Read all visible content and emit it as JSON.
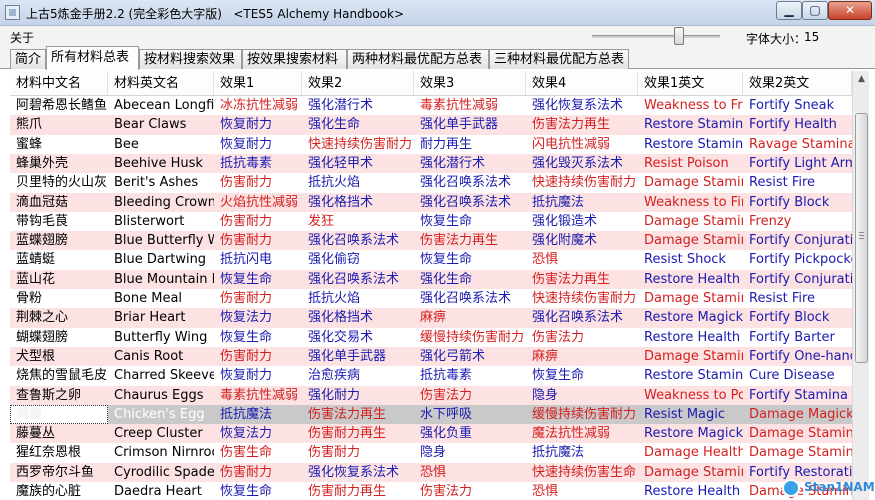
{
  "window": {
    "title": "上古5炼金手册2.2 (完全彩色大字版)   <TES5 Alchemy Handbook>"
  },
  "menu": {
    "about": "关于"
  },
  "font_size": {
    "label": "字体大小：",
    "value": "15",
    "slider_fraction": 0.68
  },
  "tabs": [
    "简介",
    "所有材料总表",
    "按材料搜索效果",
    "按效果搜索材料",
    "两种材料最优配方总表",
    "三种材料最优配方总表"
  ],
  "active_tab": 1,
  "columns": [
    "材料中文名",
    "材料英文名",
    "效果1",
    "效果2",
    "效果3",
    "效果4",
    "效果1英文",
    "效果2英文"
  ],
  "rows": [
    [
      "阿碧希恩长鳍鱼",
      "Abecean Longfin",
      "冰冻抗性减弱",
      "强化潜行术",
      "毒素抗性减弱",
      "强化恢复系法术",
      "Weakness to Frost",
      "Fortify Sneak"
    ],
    [
      "熊爪",
      "Bear Claws",
      "恢复耐力",
      "强化生命",
      "强化单手武器",
      "伤害法力再生",
      "Restore Stamina",
      "Fortify Health"
    ],
    [
      "蜜蜂",
      "Bee",
      "恢复耐力",
      "快速持续伤害耐力",
      "耐力再生",
      "闪电抗性减弱",
      "Restore Stamina",
      "Ravage Stamina"
    ],
    [
      "蜂巢外壳",
      "Beehive Husk",
      "抵抗毒素",
      "强化轻甲术",
      "强化潜行术",
      "强化毁灭系法术",
      "Resist Poison",
      "Fortify Light Armor"
    ],
    [
      "贝里特的火山灰",
      "Berit's Ashes",
      "伤害耐力",
      "抵抗火焰",
      "强化召唤系法术",
      "快速持续伤害耐力",
      "Damage Stamina",
      "Resist Fire"
    ],
    [
      "滴血冠菇",
      "Bleeding Crown",
      "火焰抗性减弱",
      "强化格挡术",
      "强化召唤系法术",
      "抵抗魔法",
      "Weakness to Fire",
      "Fortify Block"
    ],
    [
      "带钩毛茛",
      "Blisterwort",
      "伤害耐力",
      "发狂",
      "恢复生命",
      "强化锻造术",
      "Damage Stamina",
      "Frenzy"
    ],
    [
      "蓝蝶翅膀",
      "Blue Butterfly Wing",
      "伤害耐力",
      "强化召唤系法术",
      "伤害法力再生",
      "强化附魔术",
      "Damage Stamina",
      "Fortify Conjuration"
    ],
    [
      "蓝蜻蜓",
      "Blue Dartwing",
      "抵抗闪电",
      "强化偷窃",
      "恢复生命",
      "恐惧",
      "Resist Shock",
      "Fortify Pickpocket"
    ],
    [
      "蓝山花",
      "Blue Mountain Flower",
      "恢复生命",
      "强化召唤系法术",
      "强化生命",
      "伤害法力再生",
      "Restore Health",
      "Fortify Conjuration"
    ],
    [
      "骨粉",
      "Bone Meal",
      "伤害耐力",
      "抵抗火焰",
      "强化召唤系法术",
      "快速持续伤害耐力",
      "Damage Stamina",
      "Resist Fire"
    ],
    [
      "荆棘之心",
      "Briar Heart",
      "恢复法力",
      "强化格挡术",
      "麻痹",
      "强化召唤系法术",
      "Restore Magicka",
      "Fortify Block"
    ],
    [
      "蝴蝶翅膀",
      "Butterfly Wing",
      "恢复生命",
      "强化交易术",
      "缓慢持续伤害耐力",
      "伤害法力",
      "Restore Health",
      "Fortify Barter"
    ],
    [
      "犬型根",
      "Canis Root",
      "伤害耐力",
      "强化单手武器",
      "强化弓箭术",
      "麻痹",
      "Damage Stamina",
      "Fortify One-handed"
    ],
    [
      "烧焦的雪鼠毛皮",
      "Charred Skeever Hide",
      "恢复耐力",
      "治愈疾病",
      "抵抗毒素",
      "恢复生命",
      "Restore Stamina",
      "Cure Disease"
    ],
    [
      "查鲁斯之卵",
      "Chaurus Eggs",
      "毒素抗性减弱",
      "强化耐力",
      "伤害法力",
      "隐身",
      "Weakness to Poison",
      "Fortify Stamina"
    ],
    [
      "鸡蛋",
      "Chicken's Egg",
      "抵抗魔法",
      "伤害法力再生",
      "水下呼吸",
      "缓慢持续伤害耐力",
      "Resist Magic",
      "Damage Magicka Regen"
    ],
    [
      "藤蔓丛",
      "Creep Cluster",
      "恢复法力",
      "伤害耐力再生",
      "强化负重",
      "魔法抗性减弱",
      "Restore Magicka",
      "Damage Stamina Regen"
    ],
    [
      "猩红奈恩根",
      "Crimson Nirnroot",
      "伤害生命",
      "伤害耐力",
      "隐身",
      "抵抗魔法",
      "Damage Health",
      "Damage Stamina"
    ],
    [
      "西罗帝尔斗鱼",
      "Cyrodilic Spadetail",
      "伤害耐力",
      "强化恢复系法术",
      "恐惧",
      "快速持续伤害生命",
      "Damage Stamina",
      "Fortify Restoration"
    ],
    [
      "魔族的心脏",
      "Daedra Heart",
      "恢复生命",
      "伤害耐力再生",
      "伤害法力",
      "恐惧",
      "Restore Health",
      "Damage Stamina Regen"
    ]
  ],
  "cell_colors": [
    [
      "r",
      "b",
      "r",
      "b",
      "r",
      "b"
    ],
    [
      "b",
      "b",
      "b",
      "r",
      "b",
      "b"
    ],
    [
      "b",
      "r",
      "b",
      "r",
      "b",
      "r"
    ],
    [
      "b",
      "b",
      "b",
      "b",
      "r",
      "b"
    ],
    [
      "r",
      "b",
      "b",
      "r",
      "r",
      "b"
    ],
    [
      "r",
      "b",
      "b",
      "b",
      "r",
      "b"
    ],
    [
      "r",
      "r",
      "b",
      "b",
      "r",
      "r"
    ],
    [
      "r",
      "b",
      "r",
      "b",
      "r",
      "b"
    ],
    [
      "b",
      "b",
      "b",
      "r",
      "b",
      "b"
    ],
    [
      "b",
      "b",
      "b",
      "r",
      "b",
      "b"
    ],
    [
      "r",
      "b",
      "b",
      "r",
      "r",
      "b"
    ],
    [
      "b",
      "b",
      "r",
      "b",
      "b",
      "b"
    ],
    [
      "b",
      "b",
      "r",
      "r",
      "b",
      "b"
    ],
    [
      "r",
      "b",
      "b",
      "r",
      "r",
      "b"
    ],
    [
      "b",
      "b",
      "b",
      "b",
      "b",
      "b"
    ],
    [
      "r",
      "b",
      "r",
      "b",
      "r",
      "b"
    ],
    [
      "b",
      "r",
      "b",
      "r",
      "b",
      "r"
    ],
    [
      "b",
      "r",
      "b",
      "r",
      "b",
      "r"
    ],
    [
      "r",
      "r",
      "b",
      "b",
      "r",
      "r"
    ],
    [
      "r",
      "b",
      "r",
      "r",
      "r",
      "b"
    ],
    [
      "b",
      "r",
      "r",
      "r",
      "b",
      "r"
    ]
  ],
  "selected_row": 16,
  "watermark": "Stan1NAME",
  "colors": {
    "red_effect": "#d42020",
    "blue_effect": "#1b1bb0",
    "pink_row": "#fce2e2",
    "selected_row": "#c9c9c9"
  }
}
